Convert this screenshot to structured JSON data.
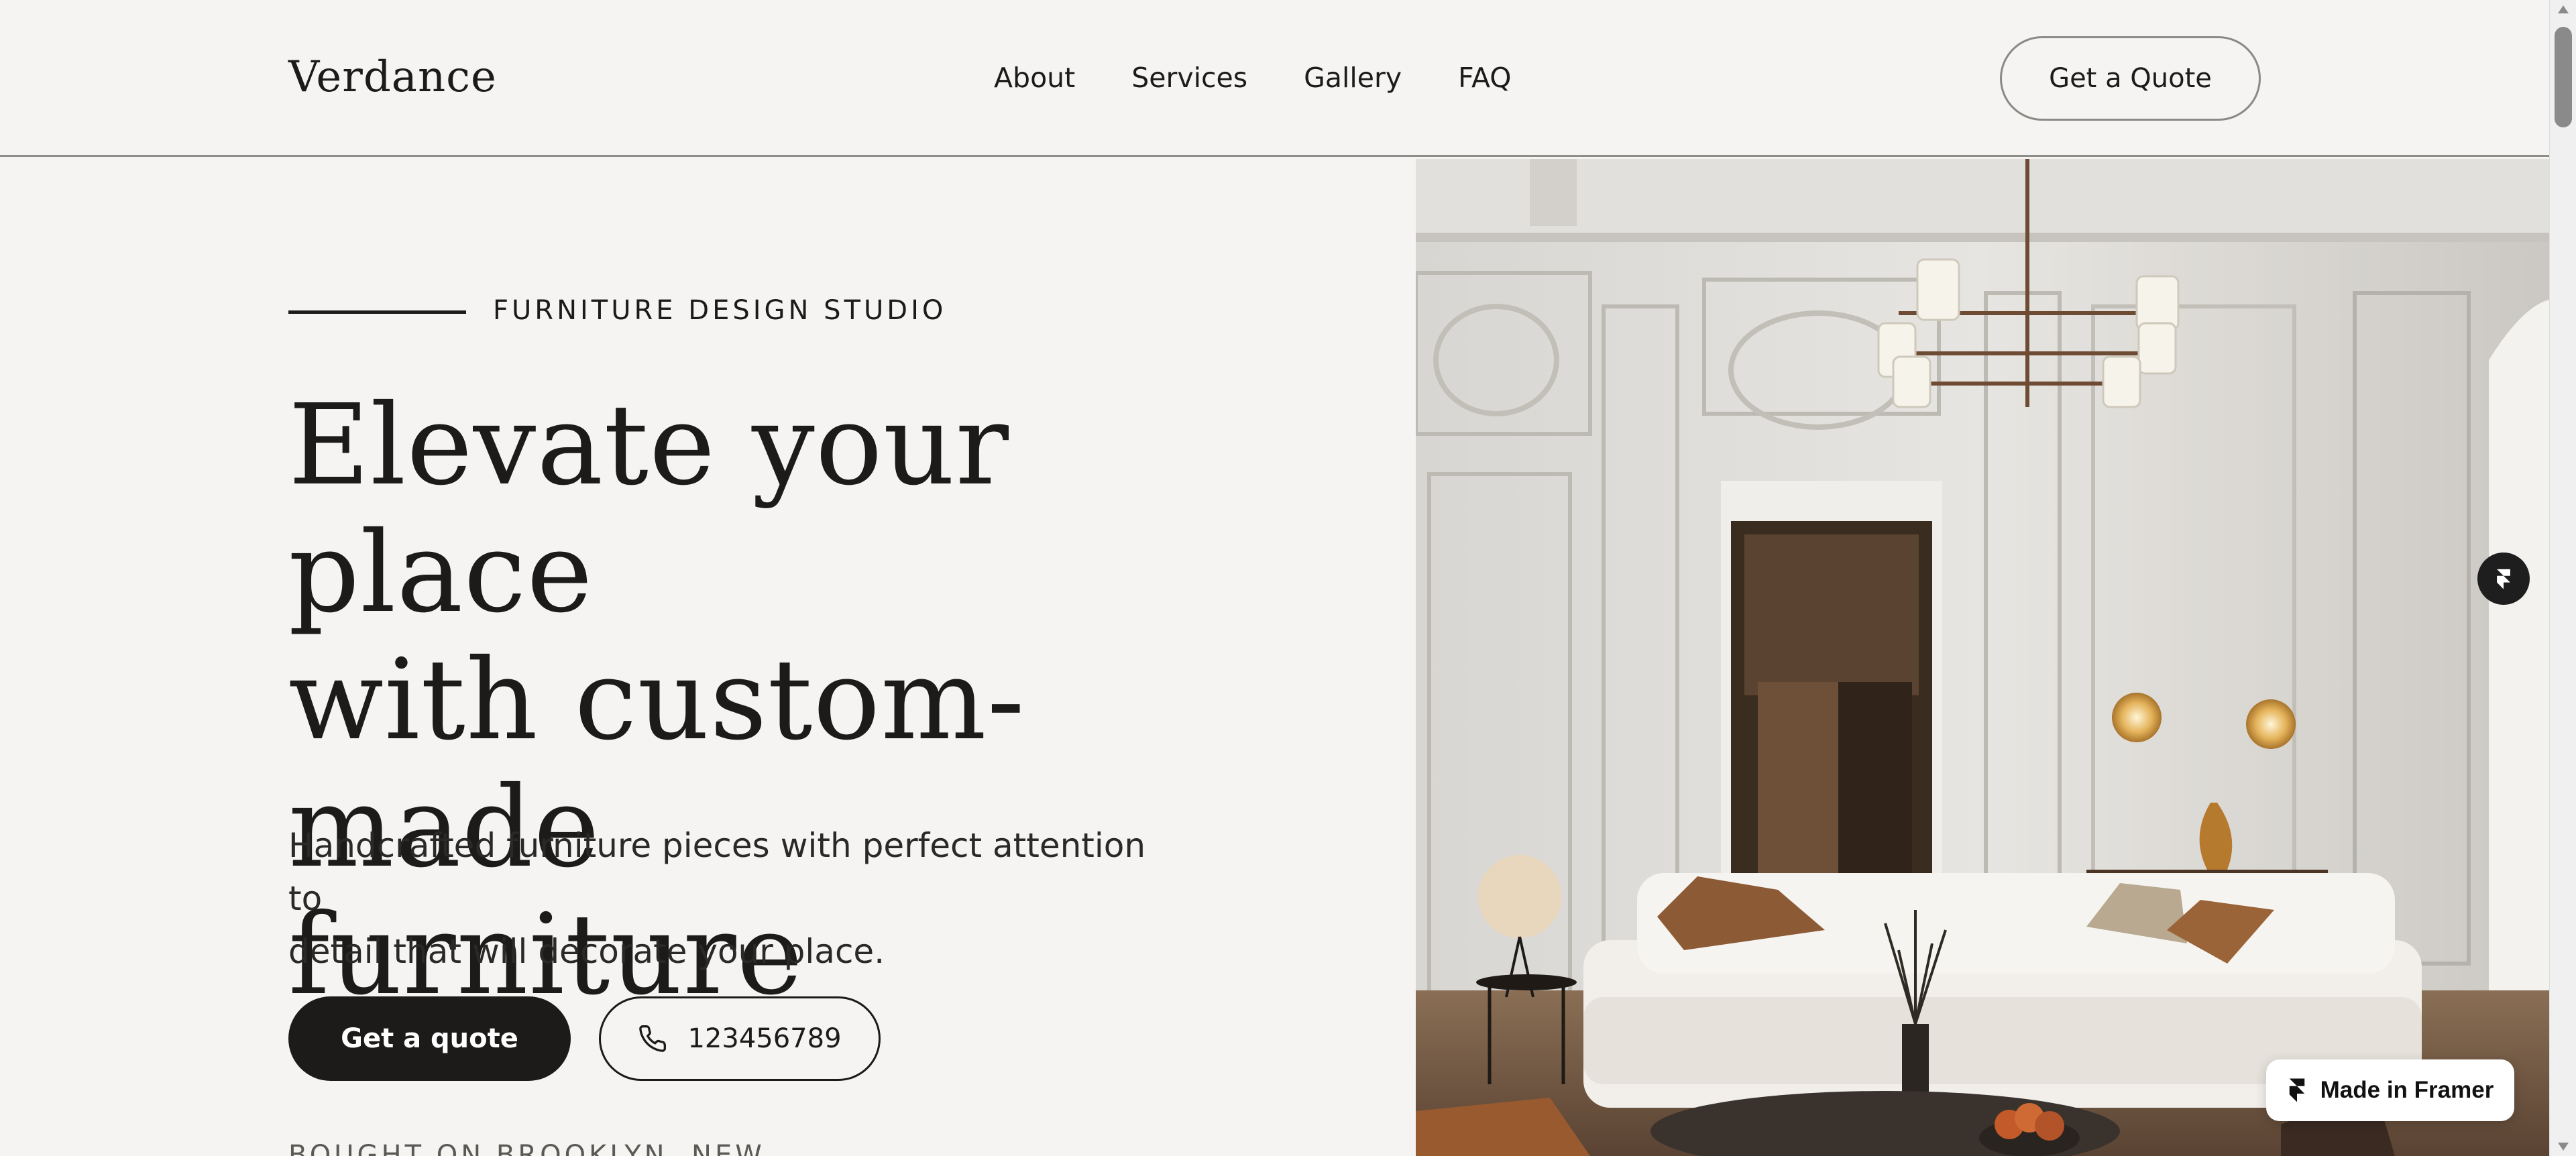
{
  "brand": {
    "name": "Verdance"
  },
  "nav": {
    "items": [
      "About",
      "Services",
      "Gallery",
      "FAQ"
    ],
    "cta_label": "Get a Quote"
  },
  "hero": {
    "eyebrow": "FURNITURE DESIGN STUDIO",
    "headline_lines": [
      "Elevate your place",
      "with custom-made",
      "furniture"
    ],
    "subtitle_lines": [
      "Handcrafted furniture pieces with perfect attention to",
      "detail that will decorate your place."
    ],
    "primary_button": "Get a quote",
    "phone_number": "123456789",
    "cutoff_text": "BOUGHT ON BROOKLYN, NEW"
  },
  "image": {
    "alt": "Interior with white sofa and chandelier"
  },
  "framer": {
    "badge_label": "Made in Framer"
  },
  "colors": {
    "background": "#f5f4f2",
    "text": "#1c1b19",
    "primary_button": "#1c1b19",
    "badge": "#ffffff"
  },
  "icons": {
    "phone": "phone-icon",
    "framer": "framer-logo-icon"
  }
}
